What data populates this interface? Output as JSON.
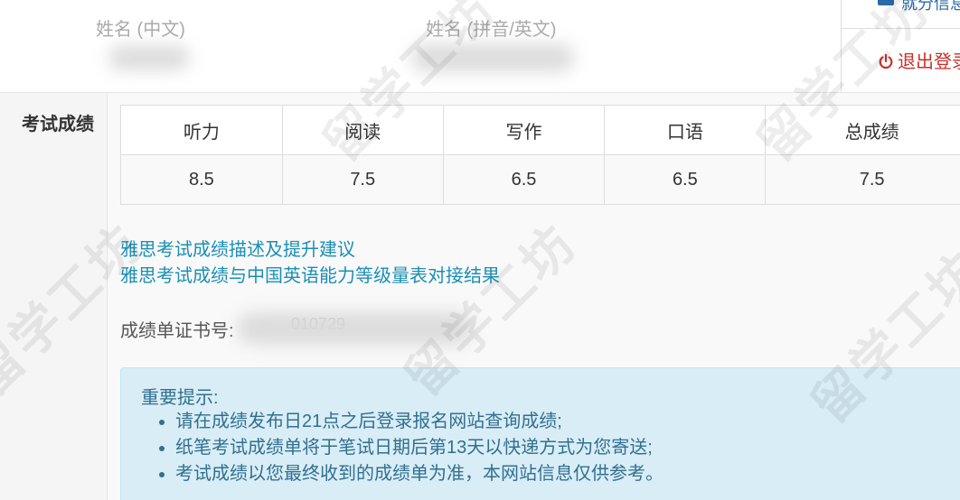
{
  "profile": {
    "name_cn_label": "姓名 (中文)",
    "name_en_label": "姓名 (拼音/英文)"
  },
  "side_menu": {
    "top_item": "就分信息",
    "logout": "退出登录"
  },
  "section_title": "考试成绩",
  "scores": {
    "headers": [
      "听力",
      "阅读",
      "写作",
      "口语",
      "总成绩"
    ],
    "values": [
      "8.5",
      "7.5",
      "6.5",
      "6.5",
      "7.5"
    ]
  },
  "links": {
    "describe": "雅思考试成绩描述及提升建议",
    "cefr": "雅思考试成绩与中国英语能力等级量表对接结果"
  },
  "certificate": {
    "label": "成绩单证书号:",
    "partial_value": "010729"
  },
  "notice": {
    "title": "重要提示:",
    "items": [
      "请在成绩发布日21点之后登录报名网站查询成绩;",
      "纸笔考试成绩单将于笔试日期后第13天以快递方式为您寄送;",
      "考试成绩以您最终收到的成绩单为准，本网站信息仅供参考。"
    ]
  },
  "watermark_text": "留学工坊",
  "colors": {
    "link": "#1a8fb5",
    "notice_bg": "#d9edf7",
    "notice_text": "#31708f",
    "logout": "#c9302c"
  }
}
